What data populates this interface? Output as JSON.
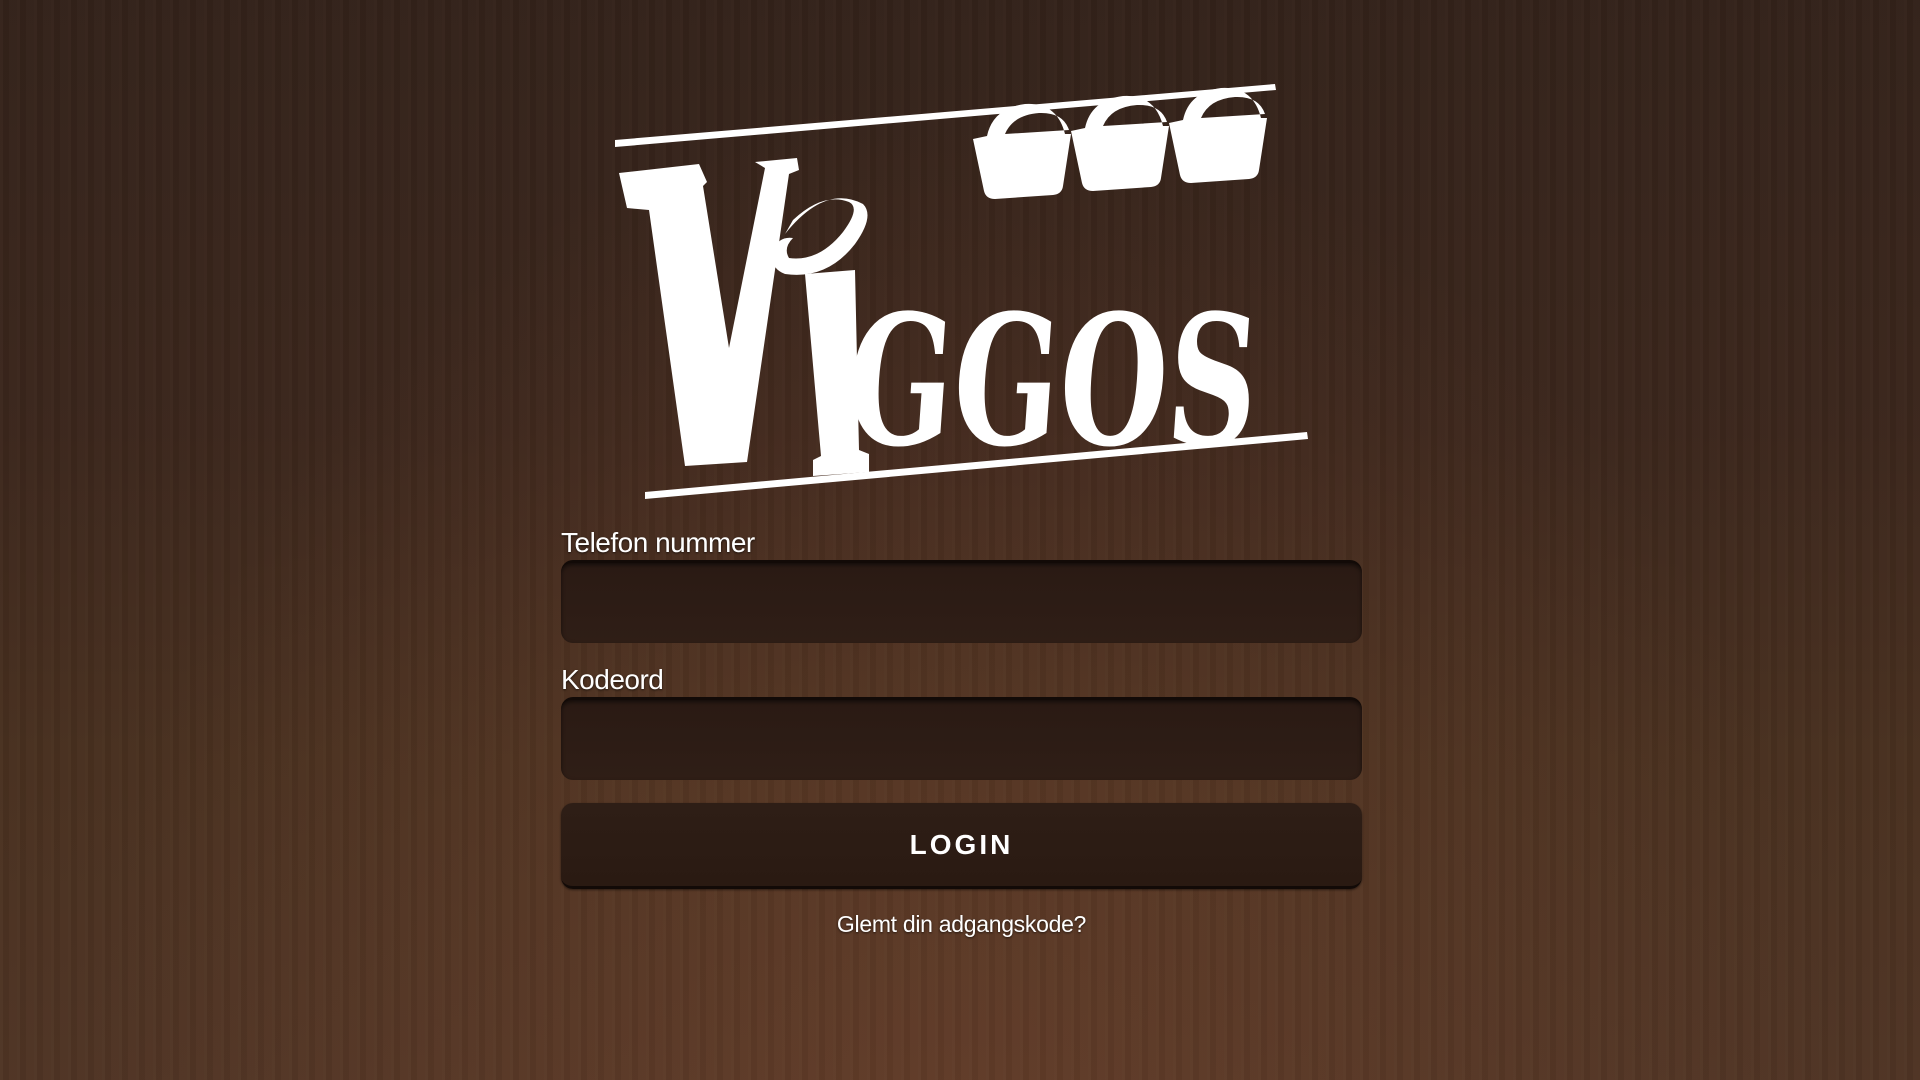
{
  "brand": {
    "logo_text": "VIGGOS"
  },
  "login_form": {
    "phone_label": "Telefon nummer",
    "phone_value": "",
    "password_label": "Kodeord",
    "password_value": "",
    "login_button_label": "LOGIN",
    "forgot_password_link": "Glemt din adgangskode?"
  },
  "colors": {
    "background": "#3b261c",
    "input_background": "#2d1c15",
    "text": "#ffffff"
  }
}
